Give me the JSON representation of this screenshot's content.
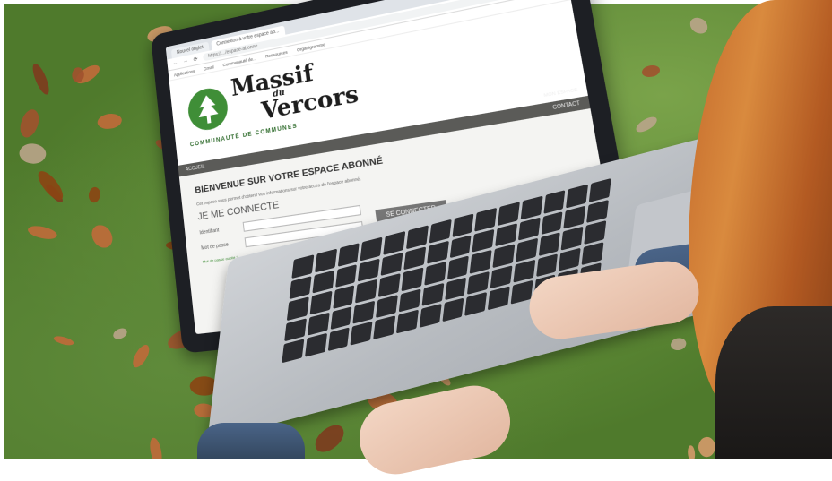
{
  "browser": {
    "tabs": [
      "Nouvel onglet",
      "Connexion à votre espace ab..."
    ],
    "url": "https://.../espace-abonne",
    "bookmarks": [
      "Applications",
      "Gmail",
      "Communauté de...",
      "Ressources",
      "Organigramme"
    ]
  },
  "site": {
    "logo": {
      "line1": "Massif",
      "line2": "du",
      "line3": "Vercors",
      "subtitle": "COMMUNAUTÉ DE COMMUNES"
    },
    "top_strip": "MON ESPACE",
    "menu": {
      "left": "ACCUEIL",
      "right": "CONTACT"
    },
    "welcome_title": "BIENVENUE SUR VOTRE ESPACE ABONNÉ",
    "intro_text": "Cet espace vous permet d'obtenir vos informations sur votre accès de l'espace abonné.",
    "login": {
      "title": "JE ME CONNECTE",
      "identifiant_label": "Identifiant",
      "password_label": "Mot de passe",
      "forgot_label": "Mot de passe oublié ?",
      "button_label": "SE CONNECTER"
    }
  },
  "colors": {
    "brand_green": "#3f8e37",
    "menu_gray": "#5b5b58"
  }
}
